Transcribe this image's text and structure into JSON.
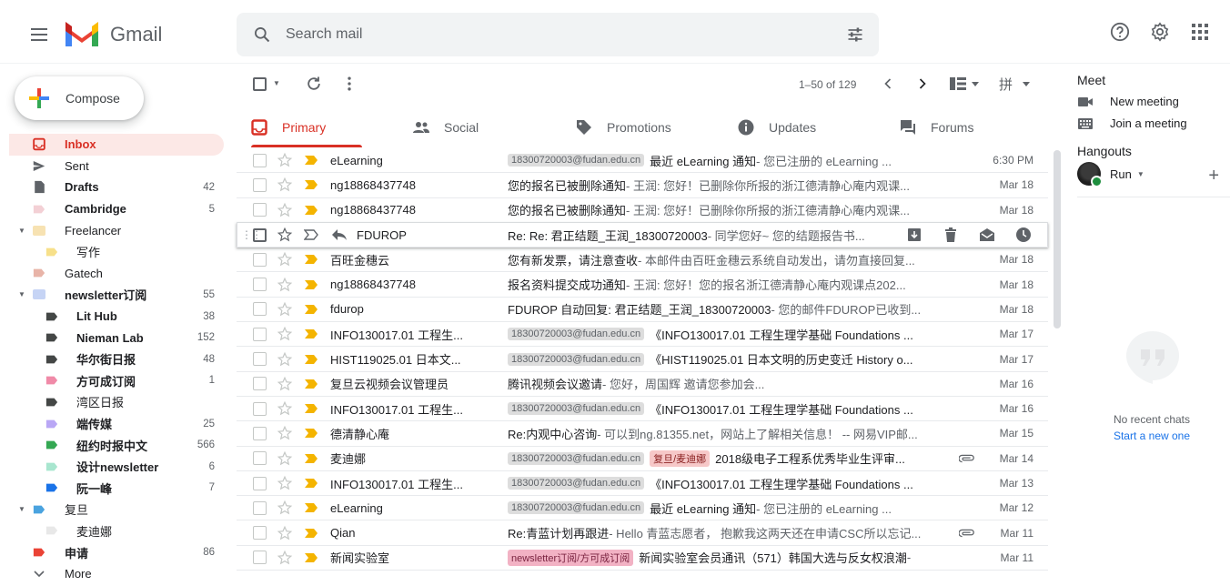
{
  "app": {
    "name": "Gmail"
  },
  "search": {
    "placeholder": "Search mail"
  },
  "compose": {
    "label": "Compose"
  },
  "sidebar": {
    "items": [
      {
        "label": "Inbox",
        "count": "",
        "bold": true,
        "active": true,
        "icon": "inbox-icon",
        "color": "#d93025"
      },
      {
        "label": "Sent",
        "count": "",
        "bold": false,
        "icon": "send-icon",
        "color": "#5f6368"
      },
      {
        "label": "Drafts",
        "count": "42",
        "bold": true,
        "icon": "draft-icon",
        "color": "#5f6368"
      },
      {
        "label": "Cambridge",
        "count": "5",
        "bold": true,
        "icon": "label-icon",
        "color": "#f3d0d5"
      },
      {
        "label": "Freelancer",
        "count": "",
        "bold": false,
        "icon": "folder-icon",
        "color": "#f7e2b2",
        "caret": true
      },
      {
        "label": "写作",
        "count": "",
        "bold": false,
        "icon": "label-icon",
        "color": "#f7e08a",
        "sub": true
      },
      {
        "label": "Gatech",
        "count": "",
        "bold": false,
        "icon": "label-icon",
        "color": "#e8b4a8"
      },
      {
        "label": "newsletter订阅",
        "count": "55",
        "bold": true,
        "icon": "folder-icon",
        "color": "#c6d4f5",
        "caret": true
      },
      {
        "label": "Lit Hub",
        "count": "38",
        "bold": true,
        "icon": "label-icon",
        "color": "#444746",
        "sub": true
      },
      {
        "label": "Nieman Lab",
        "count": "152",
        "bold": true,
        "icon": "label-icon",
        "color": "#444746",
        "sub": true
      },
      {
        "label": "华尔街日报",
        "count": "48",
        "bold": true,
        "icon": "label-icon",
        "color": "#444746",
        "sub": true
      },
      {
        "label": "方可成订阅",
        "count": "1",
        "bold": true,
        "icon": "label-icon",
        "color": "#f08aa8",
        "sub": true
      },
      {
        "label": "湾区日报",
        "count": "",
        "bold": false,
        "icon": "label-icon",
        "color": "#444746",
        "sub": true
      },
      {
        "label": "端传媒",
        "count": "25",
        "bold": true,
        "icon": "label-icon",
        "color": "#b9a7f5",
        "sub": true
      },
      {
        "label": "纽约时报中文",
        "count": "566",
        "bold": true,
        "icon": "label-icon",
        "color": "#34a853",
        "sub": true
      },
      {
        "label": "设计newsletter",
        "count": "6",
        "bold": true,
        "icon": "label-icon",
        "color": "#a8e6cf",
        "sub": true
      },
      {
        "label": "阮一峰",
        "count": "7",
        "bold": true,
        "icon": "label-icon",
        "color": "#1a73e8",
        "sub": true
      },
      {
        "label": "复旦",
        "count": "",
        "bold": false,
        "icon": "label-icon",
        "color": "#4aa3df",
        "caret": true
      },
      {
        "label": "麦迪娜",
        "count": "",
        "bold": false,
        "icon": "label-icon",
        "color": "#e8e8e8",
        "sub": true
      },
      {
        "label": "申请",
        "count": "86",
        "bold": true,
        "icon": "label-icon",
        "color": "#ea4335"
      },
      {
        "label": "More",
        "count": "",
        "bold": false,
        "icon": "chevron-down-icon",
        "color": "#5f6368"
      }
    ]
  },
  "toolbar": {
    "pager": "1–50 of 129"
  },
  "tabs": [
    {
      "label": "Primary",
      "icon": "inbox-icon"
    },
    {
      "label": "Social",
      "icon": "people-icon"
    },
    {
      "label": "Promotions",
      "icon": "tag-icon"
    },
    {
      "label": "Updates",
      "icon": "info-icon"
    },
    {
      "label": "Forums",
      "icon": "forum-icon"
    }
  ],
  "emails": [
    {
      "sender": "eLearning",
      "chip": "18300720003@fudan.edu.cn",
      "chip_style": "grey",
      "subject": "最近 eLearning 通知",
      "snippet": " - 您已注册的 eLearning ...",
      "date": "6:30 PM",
      "unread": true
    },
    {
      "sender": "ng18868437748",
      "chip": "",
      "subject": "您的报名已被删除通知",
      "snippet": " - 王润: 您好！已删除你所报的浙江德清静心庵内观课...",
      "date": "Mar 18",
      "unread": true
    },
    {
      "sender": "ng18868437748",
      "chip": "",
      "subject": "您的报名已被删除通知",
      "snippet": " - 王润: 您好！已删除你所报的浙江德清静心庵内观课...",
      "date": "Mar 18",
      "unread": true
    },
    {
      "sender": "FDUROP",
      "chip": "",
      "subject": "Re: Re: 君正结题_王润_18300720003",
      "snippet": " - 同学您好~ 您的结题报告书...",
      "date": "",
      "unread": true,
      "hover": true
    },
    {
      "sender": "百旺金穗云",
      "chip": "",
      "subject": "您有新发票，请注意查收",
      "snippet": " - 本邮件由百旺金穗云系统自动发出，请勿直接回复...",
      "date": "Mar 18",
      "unread": true
    },
    {
      "sender": "ng18868437748",
      "chip": "",
      "subject": "报名资料提交成功通知",
      "snippet": " - 王润:  您好！您的报名浙江德清静心庵内观课点202...",
      "date": "Mar 18",
      "unread": true
    },
    {
      "sender": "fdurop",
      "chip": "",
      "subject": "FDUROP 自动回复: 君正结题_王润_18300720003",
      "snippet": " - 您的邮件FDUROP已收到...",
      "date": "Mar 18",
      "unread": true
    },
    {
      "sender": "INFO130017.01 工程生...",
      "chip": "18300720003@fudan.edu.cn",
      "chip_style": "grey",
      "subject": "《INFO130017.01 工程生理学基础 Foundations ...",
      "snippet": "",
      "date": "Mar 17",
      "unread": true
    },
    {
      "sender": "HIST119025.01 日本文...",
      "chip": "18300720003@fudan.edu.cn",
      "chip_style": "grey",
      "subject": "《HIST119025.01 日本文明的历史变迁 History o...",
      "snippet": "",
      "date": "Mar 17",
      "unread": true
    },
    {
      "sender": "复旦云视频会议管理员",
      "chip": "",
      "subject": "腾讯视频会议邀请",
      "snippet": " - 您好，周国辉 邀请您参加会...",
      "date": "Mar 16",
      "unread": true,
      "chip_before": "18300720003@fudan.edu.cn"
    },
    {
      "sender": "INFO130017.01 工程生...",
      "chip": "18300720003@fudan.edu.cn",
      "chip_style": "grey",
      "subject": "《INFO130017.01 工程生理学基础 Foundations ...",
      "snippet": "",
      "date": "Mar 16",
      "unread": true
    },
    {
      "sender": "德清静心庵",
      "chip": "",
      "subject": "Re:内观中心咨询",
      "snippet": " - 可以到ng.81355.net，网站上了解相关信息！ -- 网易VIP邮...",
      "date": "Mar 15",
      "unread": true
    },
    {
      "sender": "麦迪娜",
      "chip": "18300720003@fudan.edu.cn",
      "chip_style": "grey",
      "chip2": "复旦/麦迪娜",
      "subject": "2018级电子工程系优秀毕业生评审...",
      "snippet": "",
      "date": "Mar 14",
      "unread": true,
      "attach": true
    },
    {
      "sender": "INFO130017.01 工程生...",
      "chip": "18300720003@fudan.edu.cn",
      "chip_style": "grey",
      "subject": "《INFO130017.01 工程生理学基础 Foundations ...",
      "snippet": "",
      "date": "Mar 13",
      "unread": true
    },
    {
      "sender": "eLearning",
      "chip": "18300720003@fudan.edu.cn",
      "chip_style": "grey",
      "subject": "最近 eLearning 通知",
      "snippet": " - 您已注册的 eLearning ...",
      "date": "Mar 12",
      "unread": true
    },
    {
      "sender": "Qian",
      "chip": "",
      "subject": "Re:青蓝计划再跟进",
      "snippet": " - Hello 青蓝志愿者， 抱歉我这两天还在申请CSC所以忘记...",
      "date": "Mar 11",
      "unread": true,
      "attach": true
    },
    {
      "sender": "新闻实验室",
      "chip": "newsletter订阅/方可成订阅",
      "chip_style": "pink",
      "subject": "新闻实验室会员通讯（571）韩国大选与反女权浪潮",
      "snippet": " - ",
      "date": "Mar 11",
      "unread": true
    }
  ],
  "right_panel": {
    "meet_title": "Meet",
    "new_meeting": "New meeting",
    "join_meeting": "Join a meeting",
    "hangouts_title": "Hangouts",
    "user_name": "Run",
    "no_chats": "No recent chats",
    "start_new": "Start a new one"
  },
  "colors": {
    "accent": "#d93025",
    "link": "#1a73e8"
  }
}
